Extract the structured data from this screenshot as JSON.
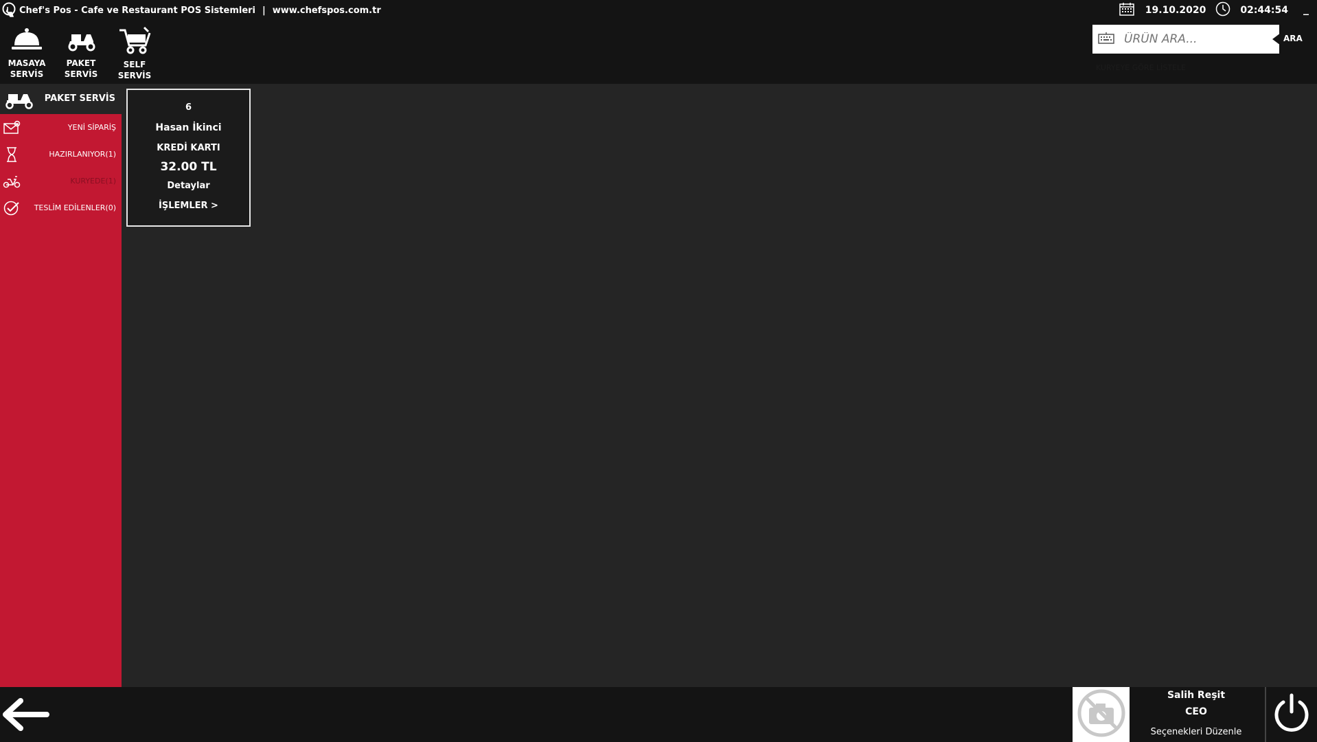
{
  "titlebar": {
    "app_title": "Chef's Pos - Cafe ve Restaurant POS Sistemleri",
    "separator": "|",
    "website": "www.chefspos.com.tr",
    "date": "19.10.2020",
    "time": "02:44:54",
    "minimize": "_"
  },
  "services": [
    {
      "label": "MASAYA\nSERVİS",
      "icon": "cloche-icon"
    },
    {
      "label": "PAKET\nSERVİS",
      "icon": "scooter-icon"
    },
    {
      "label": "SELF\nSERVİS",
      "icon": "shopping-cart-icon"
    }
  ],
  "search": {
    "placeholder": "ÜRÜN ARA...",
    "button_label": "ARA",
    "courier_link": "KURYEYE GÖRE LİSTELE"
  },
  "sidebar": {
    "header_label": "PAKET SERVİS",
    "items": [
      {
        "label": "YENİ SİPARİŞ",
        "icon": "envelope-icon"
      },
      {
        "label": "HAZIRLANIYOR(1)",
        "icon": "hourglass-icon"
      },
      {
        "label": "KURYEDE(1)",
        "icon": "moped-icon"
      },
      {
        "label": "TESLİM EDİLENLER(0)",
        "icon": "check-circle-icon"
      }
    ]
  },
  "order": {
    "number": "6",
    "customer": "Hasan İkinci",
    "payment": "KREDİ KARTI",
    "amount": "32.00 TL",
    "details_label": "Detaylar",
    "actions_label": "İŞLEMLER >"
  },
  "user": {
    "name": "Salih Reşit",
    "role": "CEO",
    "edit_options": "Seçenekleri Düzenle"
  },
  "colors": {
    "accent_red": "#c21832",
    "bar_bg": "#141414",
    "main_bg": "#252525"
  }
}
